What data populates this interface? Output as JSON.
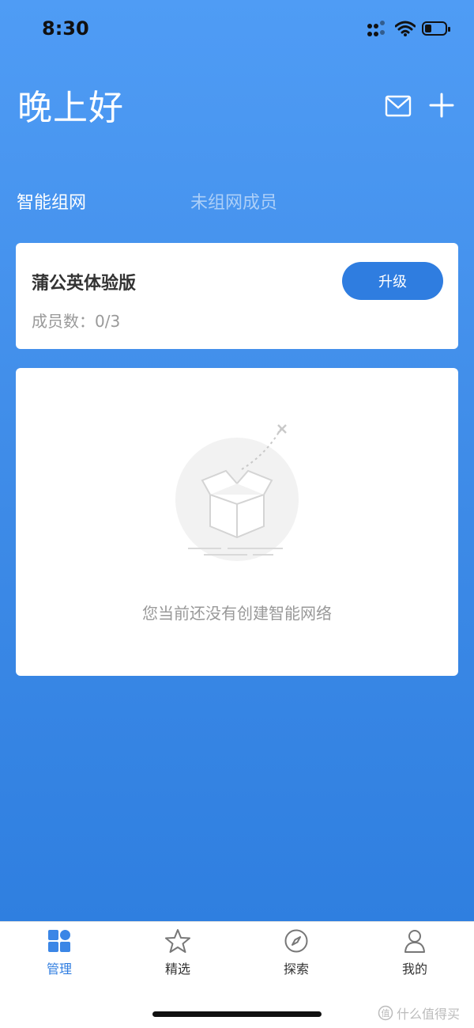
{
  "status_bar": {
    "time": "8:30"
  },
  "header": {
    "greeting": "晚上好",
    "icons": [
      "mail-icon",
      "plus-icon"
    ]
  },
  "tabs": [
    {
      "label": "智能组网",
      "active": true
    },
    {
      "label": "未组网成员",
      "active": false
    }
  ],
  "plan_card": {
    "title": "蒲公英体验版",
    "members": "成员数：0/3",
    "upgrade_label": "升级"
  },
  "empty_state": {
    "message": "您当前还没有创建智能网络"
  },
  "bottom_nav": [
    {
      "label": "管理",
      "icon": "grid-icon",
      "active": true
    },
    {
      "label": "精选",
      "icon": "star-icon",
      "active": false
    },
    {
      "label": "探索",
      "icon": "compass-icon",
      "active": false
    },
    {
      "label": "我的",
      "icon": "person-icon",
      "active": false
    }
  ],
  "watermark": "什么值得买",
  "colors": {
    "accent": "#2f7de0",
    "background_top": "#4f9cf5",
    "background_bottom": "#2f7fe0"
  }
}
